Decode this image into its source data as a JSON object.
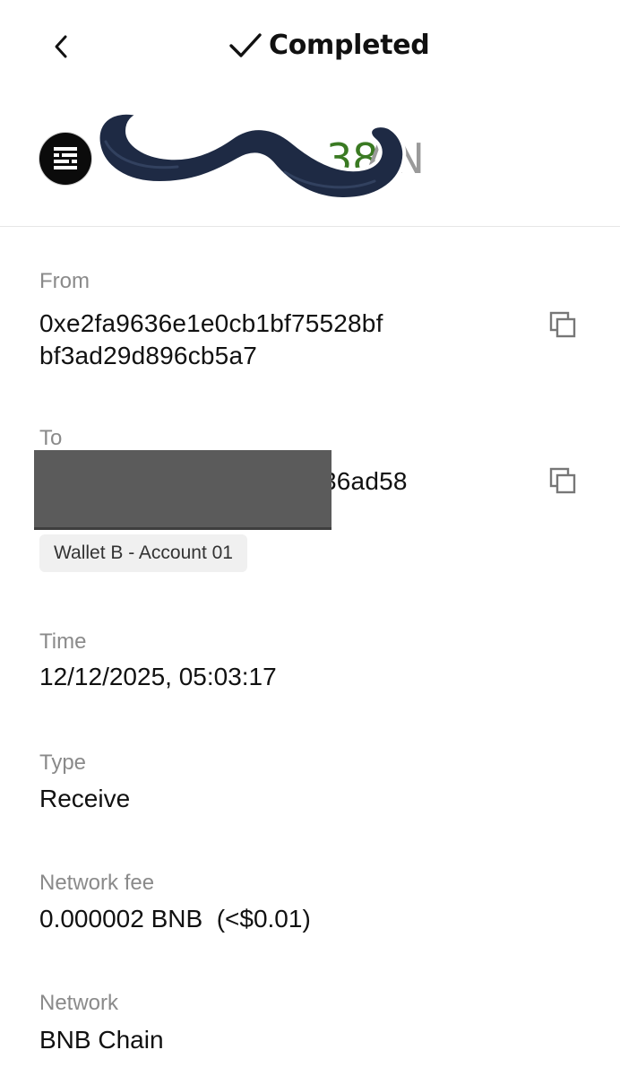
{
  "header": {
    "back_icon": "chevron-left-icon",
    "status_icon": "checkmark-icon",
    "status_text": "Completed"
  },
  "amount": {
    "visible_value": "38",
    "unit": "AN",
    "value_color": "#3a7a22",
    "unit_color": "#9a9a9a",
    "token_icon": "token-logo-icon",
    "overlay": "mustache-sticker"
  },
  "fields": {
    "from": {
      "label": "From",
      "line1": "0xe2fa9636e1e0cb1bf75528bf",
      "line2": "bf3ad29d896cb5a7",
      "copy_icon": "copy-icon"
    },
    "to": {
      "label": "To",
      "visible_suffix": "36ad58",
      "wallet_tag": "Wallet B - Account 01",
      "copy_icon": "copy-icon"
    },
    "time": {
      "label": "Time",
      "value": "12/12/2025, 05:03:17"
    },
    "type": {
      "label": "Type",
      "value": "Receive"
    },
    "network_fee": {
      "label": "Network fee",
      "value": "0.000002 BNB  (<$0.01)"
    },
    "network": {
      "label": "Network",
      "value": "BNB Chain"
    }
  }
}
